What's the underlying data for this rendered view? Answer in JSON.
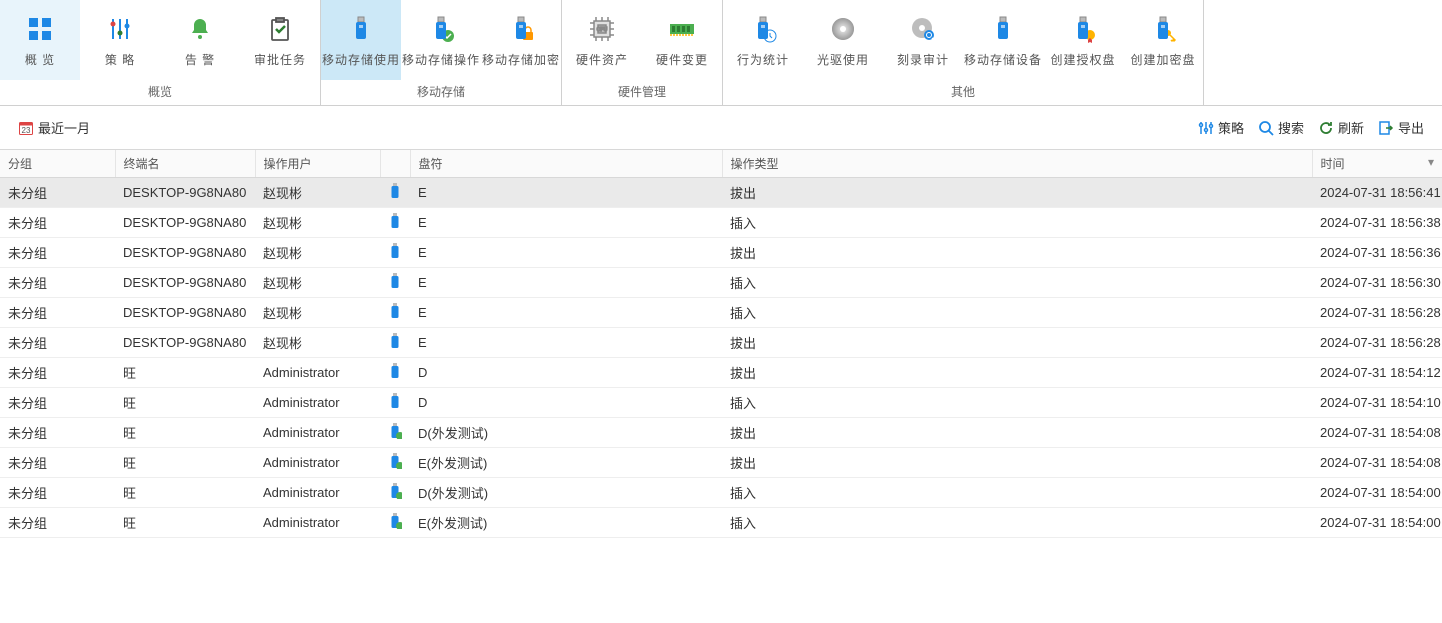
{
  "ribbon": {
    "groups": [
      {
        "label": "概览",
        "items": [
          {
            "id": "overview",
            "label": "概 览",
            "icon": "grid"
          },
          {
            "id": "policy",
            "label": "策 略",
            "icon": "sliders"
          },
          {
            "id": "alert",
            "label": "告 警",
            "icon": "bell"
          },
          {
            "id": "approval",
            "label": "审批任务",
            "icon": "clipboard"
          }
        ]
      },
      {
        "label": "移动存储",
        "items": [
          {
            "id": "usb-use",
            "label": "移动存储使用",
            "icon": "usb-blue",
            "active": true
          },
          {
            "id": "usb-op",
            "label": "移动存储操作",
            "icon": "usb-green"
          },
          {
            "id": "usb-enc",
            "label": "移动存储加密",
            "icon": "usb-lock"
          }
        ]
      },
      {
        "label": "硬件管理",
        "items": [
          {
            "id": "hw-asset",
            "label": "硬件资产",
            "icon": "cpu"
          },
          {
            "id": "hw-change",
            "label": "硬件变更",
            "icon": "ram"
          }
        ]
      },
      {
        "label": "其他",
        "items": [
          {
            "id": "behavior",
            "label": "行为统计",
            "icon": "usb-clock"
          },
          {
            "id": "cd-use",
            "label": "光驱使用",
            "icon": "disc"
          },
          {
            "id": "burn-audit",
            "label": "刻录审计",
            "icon": "disc-search"
          },
          {
            "id": "usb-dev",
            "label": "移动存储设备",
            "icon": "usb-plain"
          },
          {
            "id": "auth-disk",
            "label": "创建授权盘",
            "icon": "usb-cert"
          },
          {
            "id": "enc-disk",
            "label": "创建加密盘",
            "icon": "usb-key"
          }
        ]
      }
    ]
  },
  "toolbar": {
    "date_label": "最近一月",
    "date_day": "23",
    "policy": "策略",
    "search": "搜索",
    "refresh": "刷新",
    "export": "导出"
  },
  "table": {
    "headers": {
      "group": "分组",
      "terminal": "终端名",
      "user": "操作用户",
      "icon": "",
      "drive": "盘符",
      "optype": "操作类型",
      "time": "时间"
    },
    "rows": [
      {
        "group": "未分组",
        "terminal": "DESKTOP-9G8NA80",
        "user": "赵现彬",
        "iconType": "usb",
        "drive": "E",
        "optype": "拔出",
        "time": "2024-07-31 18:56:41",
        "sel": true
      },
      {
        "group": "未分组",
        "terminal": "DESKTOP-9G8NA80",
        "user": "赵现彬",
        "iconType": "usb",
        "drive": "E",
        "optype": "插入",
        "time": "2024-07-31 18:56:38"
      },
      {
        "group": "未分组",
        "terminal": "DESKTOP-9G8NA80",
        "user": "赵现彬",
        "iconType": "usb",
        "drive": "E",
        "optype": "拔出",
        "time": "2024-07-31 18:56:36"
      },
      {
        "group": "未分组",
        "terminal": "DESKTOP-9G8NA80",
        "user": "赵现彬",
        "iconType": "usb",
        "drive": "E",
        "optype": "插入",
        "time": "2024-07-31 18:56:30"
      },
      {
        "group": "未分组",
        "terminal": "DESKTOP-9G8NA80",
        "user": "赵现彬",
        "iconType": "usb",
        "drive": "E",
        "optype": "插入",
        "time": "2024-07-31 18:56:28"
      },
      {
        "group": "未分组",
        "terminal": "DESKTOP-9G8NA80",
        "user": "赵现彬",
        "iconType": "usb",
        "drive": "E",
        "optype": "拔出",
        "time": "2024-07-31 18:56:28"
      },
      {
        "group": "未分组",
        "terminal": "旺",
        "user": "Administrator",
        "iconType": "usb",
        "drive": "D",
        "optype": "拔出",
        "time": "2024-07-31 18:54:12"
      },
      {
        "group": "未分组",
        "terminal": "旺",
        "user": "Administrator",
        "iconType": "usb",
        "drive": "D",
        "optype": "插入",
        "time": "2024-07-31 18:54:10"
      },
      {
        "group": "未分组",
        "terminal": "旺",
        "user": "Administrator",
        "iconType": "usb-green",
        "drive": "D(外发测试)",
        "optype": "拔出",
        "time": "2024-07-31 18:54:08"
      },
      {
        "group": "未分组",
        "terminal": "旺",
        "user": "Administrator",
        "iconType": "usb-green",
        "drive": "E(外发测试)",
        "optype": "拔出",
        "time": "2024-07-31 18:54:08"
      },
      {
        "group": "未分组",
        "terminal": "旺",
        "user": "Administrator",
        "iconType": "usb-green",
        "drive": "D(外发测试)",
        "optype": "插入",
        "time": "2024-07-31 18:54:00"
      },
      {
        "group": "未分组",
        "terminal": "旺",
        "user": "Administrator",
        "iconType": "usb-green",
        "drive": "E(外发测试)",
        "optype": "插入",
        "time": "2024-07-31 18:54:00"
      }
    ]
  }
}
